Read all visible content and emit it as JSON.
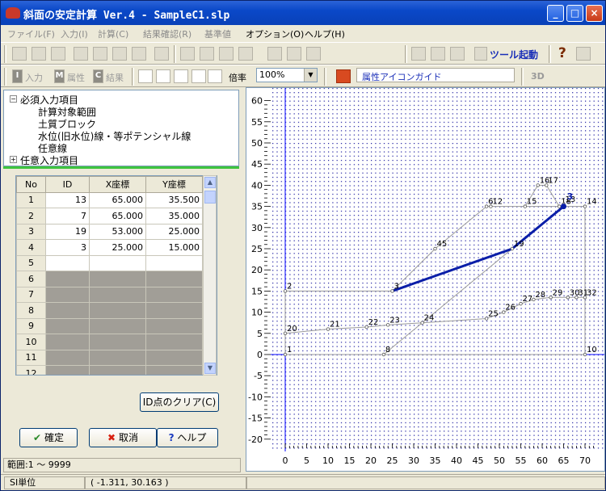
{
  "window": {
    "title": "斜面の安定計算 Ver.4 - SampleC1.slp",
    "min": "_",
    "max": "□",
    "close": "×"
  },
  "menu": [
    {
      "label": "ファイル(F)",
      "enabled": false
    },
    {
      "label": "入力(I)",
      "enabled": false
    },
    {
      "label": "計算(C)",
      "enabled": false
    },
    {
      "label": "結果確認(R)",
      "enabled": false
    },
    {
      "label": "基準値",
      "enabled": false
    },
    {
      "label": "オプション(O)",
      "enabled": true
    },
    {
      "label": "ヘルプ(H)",
      "enabled": true
    }
  ],
  "toolbar1": {
    "tool_start": "ツール起動",
    "help_glyph": "?"
  },
  "toolbar2": {
    "input": "入力",
    "input_glyph": "I",
    "attr": "属性",
    "attr_glyph": "M",
    "result": "結果",
    "result_glyph": "C",
    "zoom_label": "倍率",
    "zoom_value": "100%",
    "guide": "属性アイコンガイド",
    "threed": "3D"
  },
  "tree": {
    "root": "必須入力項目",
    "items": [
      "計算対象範囲",
      "土質ブロック",
      "水位(旧水位)線・等ポテンシャル線",
      "任意線"
    ],
    "optional": "任意入力項目"
  },
  "grid": {
    "headers": [
      "No",
      "ID",
      "X座標",
      "Y座標"
    ],
    "rows": [
      {
        "no": "1",
        "id": "13",
        "x": "65.000",
        "y": "35.500"
      },
      {
        "no": "2",
        "id": "7",
        "x": "65.000",
        "y": "35.000"
      },
      {
        "no": "3",
        "id": "19",
        "x": "53.000",
        "y": "25.000"
      },
      {
        "no": "4",
        "id": "3",
        "x": "25.000",
        "y": "15.000"
      },
      {
        "no": "5",
        "id": "",
        "x": "",
        "y": ""
      },
      {
        "no": "6",
        "id": "",
        "x": "",
        "y": ""
      },
      {
        "no": "7",
        "id": "",
        "x": "",
        "y": ""
      },
      {
        "no": "8",
        "id": "",
        "x": "",
        "y": ""
      },
      {
        "no": "9",
        "id": "",
        "x": "",
        "y": ""
      },
      {
        "no": "10",
        "id": "",
        "x": "",
        "y": ""
      },
      {
        "no": "11",
        "id": "",
        "x": "",
        "y": ""
      },
      {
        "no": "12",
        "id": "",
        "x": "",
        "y": ""
      }
    ]
  },
  "buttons": {
    "clear_id": "ID点のクリア(C)",
    "ok": "確定",
    "cancel": "取消",
    "help": "ヘルプ"
  },
  "status": {
    "range": "範囲:1 ～ 9999",
    "unit": "SI単位",
    "coords": "(  -1.311,   30.163 )"
  },
  "plot": {
    "x_range": [
      0,
      70
    ],
    "y_range": [
      -20,
      60
    ],
    "x_ticks": [
      0,
      5,
      10,
      15,
      20,
      25,
      30,
      35,
      40,
      45,
      50,
      55,
      60,
      65,
      70
    ],
    "y_ticks": [
      60,
      55,
      50,
      45,
      40,
      35,
      30,
      25,
      20,
      15,
      10,
      5,
      0,
      -5,
      -10,
      -15,
      -20
    ],
    "points": [
      {
        "id": "1",
        "x": 0,
        "y": 0
      },
      {
        "id": "2",
        "x": 0,
        "y": 15
      },
      {
        "id": "3",
        "x": 25,
        "y": 15
      },
      {
        "id": "45",
        "x": 35,
        "y": 25
      },
      {
        "id": "6",
        "x": 47,
        "y": 35
      },
      {
        "id": "12",
        "x": 48,
        "y": 35
      },
      {
        "id": "15",
        "x": 56,
        "y": 35
      },
      {
        "id": "16",
        "x": 59,
        "y": 40
      },
      {
        "id": "17",
        "x": 61,
        "y": 40
      },
      {
        "id": "18",
        "x": 64,
        "y": 35
      },
      {
        "id": "13",
        "x": 65,
        "y": 35.5
      },
      {
        "id": "14",
        "x": 70,
        "y": 35
      },
      {
        "id": "19",
        "x": 53,
        "y": 25
      },
      {
        "id": "8",
        "x": 23,
        "y": 0
      },
      {
        "id": "10",
        "x": 70,
        "y": 0
      },
      {
        "id": "20",
        "x": 0,
        "y": 5
      },
      {
        "id": "21",
        "x": 10,
        "y": 6
      },
      {
        "id": "22",
        "x": 19,
        "y": 6.5
      },
      {
        "id": "23",
        "x": 24,
        "y": 7
      },
      {
        "id": "24",
        "x": 32,
        "y": 7.5
      },
      {
        "id": "25",
        "x": 47,
        "y": 8.5
      },
      {
        "id": "26",
        "x": 51,
        "y": 10
      },
      {
        "id": "27",
        "x": 55,
        "y": 12
      },
      {
        "id": "28",
        "x": 58,
        "y": 13
      },
      {
        "id": "29",
        "x": 62,
        "y": 13.5
      },
      {
        "id": "30",
        "x": 66,
        "y": 13.5
      },
      {
        "id": "31",
        "x": 68,
        "y": 13.5
      },
      {
        "id": "32",
        "x": 70,
        "y": 13.5
      }
    ],
    "selected_line": [
      "3",
      "19",
      "7"
    ],
    "selected_label": "3",
    "point7": {
      "x": 65,
      "y": 35
    }
  },
  "colors": {
    "selected": "#0a1ea8",
    "line": "#9a9a9a",
    "axis": "#0000ff",
    "dots": "#1a1aa0"
  }
}
